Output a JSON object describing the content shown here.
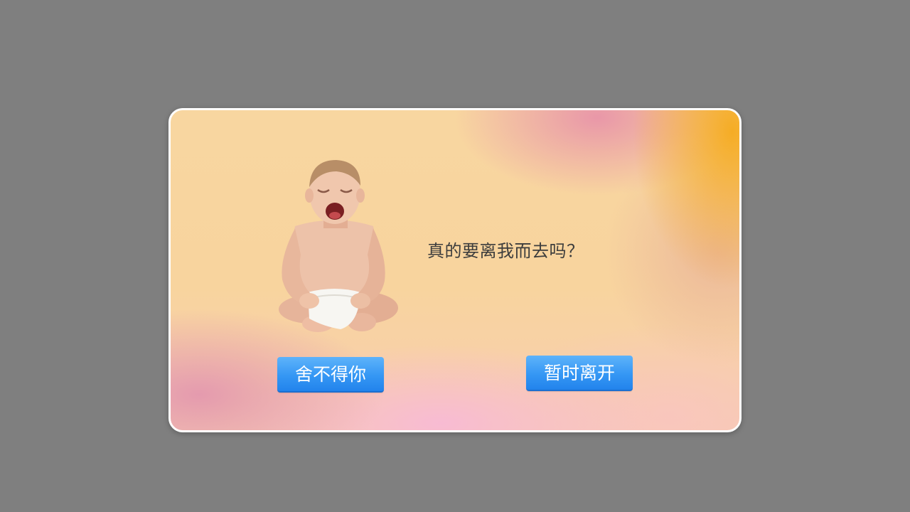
{
  "dialog": {
    "message": "真的要离我而去吗？",
    "stay_button_label": "舍不得你",
    "leave_button_label": "暂时离开",
    "image": "crying-baby-image"
  },
  "colors": {
    "overlay": "#7f7f7f",
    "button": "#3597f4",
    "text": "#3d3d3d"
  }
}
